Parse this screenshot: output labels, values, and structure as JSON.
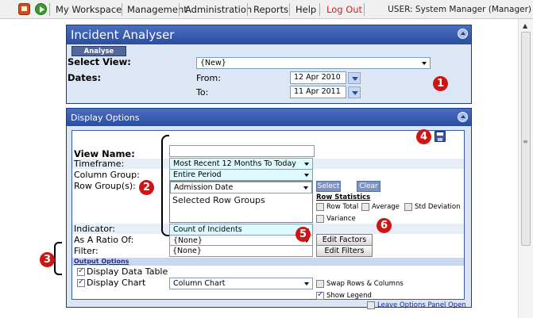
{
  "nav": {
    "items": [
      "My Workspace",
      "Management",
      "Administration",
      "Reports",
      "Help",
      "Log Out"
    ],
    "user": "USER: System Manager (Manager)"
  },
  "analyser": {
    "title": "Incident Analyser",
    "analyse_label": "Analyse",
    "select_view_label": "Select View:",
    "select_view_value": "{New}",
    "dates_label": "Dates:",
    "from_label": "From:",
    "from_value": "12 Apr 2010",
    "to_label": "To:",
    "to_value": "11 Apr 2011"
  },
  "display": {
    "title": "Display Options",
    "view_name_label": "View Name:",
    "view_name_value": "",
    "timeframe_label": "Timeframe:",
    "timeframe_value": "Most Recent 12 Months To Today",
    "column_group_label": "Column Group:",
    "column_group_value": "Entire Period",
    "row_groups_label": "Row Group(s):",
    "row_groups_value": "Admission Date",
    "selected_row_groups": "Selected Row Groups",
    "select_label": "Select",
    "clear_label": "Clear",
    "row_statistics_label": "Row Statistics",
    "stats": {
      "row_total": "Row Total",
      "average": "Average",
      "std_deviation": "Std Deviation",
      "variance": "Variance"
    },
    "indicator_label": "Indicator:",
    "indicator_value": "Count of Incidents",
    "ratio_label": "As A Ratio Of:",
    "ratio_value": "{None}",
    "filter_label": "Filter:",
    "filter_value": "{None}",
    "edit_factors_label": "Edit Factors",
    "edit_filters_label": "Edit Filters",
    "output_options_label": "Output Options",
    "display_data_table_label": "Display Data Table",
    "display_chart_label": "Display Chart",
    "chart_type_value": "Column Chart",
    "swap_label": "Swap Rows & Columns",
    "show_legend_label": "Show Legend",
    "leave_open_label": "Leave Options Panel Open"
  },
  "badges": [
    "1",
    "2",
    "3",
    "4",
    "5",
    "6"
  ]
}
